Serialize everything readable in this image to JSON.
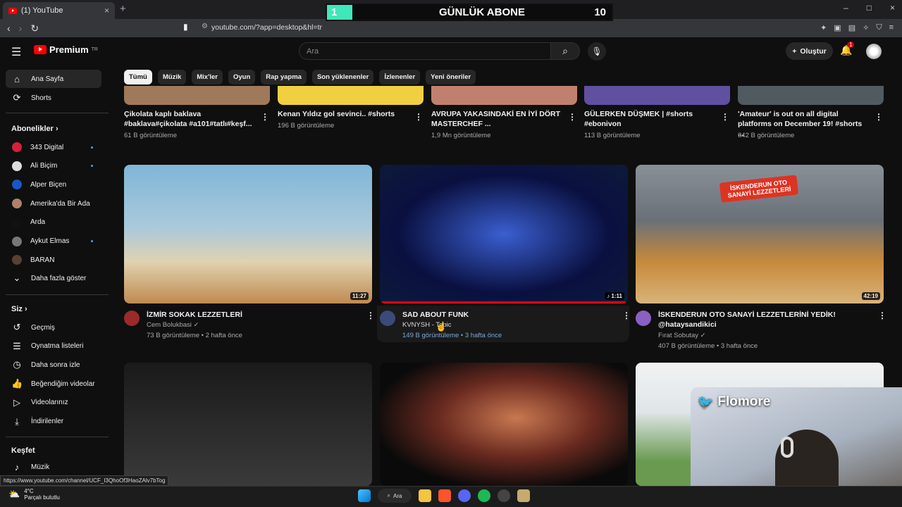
{
  "browser": {
    "tab_title": "(1) YouTube",
    "tab_close": "×",
    "new_tab": "+",
    "url": "youtube.com/?app=desktop&hl=tr",
    "window_controls": [
      "–",
      "□",
      "×"
    ]
  },
  "stream_overlay": {
    "left": "1",
    "title": "GÜNLÜK ABONE",
    "right": "10"
  },
  "header": {
    "brand": "Premium",
    "brand_sup": "TR",
    "search_placeholder": "Ara",
    "create_label": "Oluştur",
    "notifications": "1"
  },
  "sidebar": {
    "main": [
      {
        "label": "Ana Sayfa",
        "icon": "home-icon"
      },
      {
        "label": "Shorts",
        "icon": "shorts-icon"
      }
    ],
    "subscriptions_title": "Abonelikler",
    "subscriptions": [
      {
        "label": "343 Digital",
        "color": "#d6203a",
        "dot": true
      },
      {
        "label": "Ali Biçim",
        "color": "#dddddd",
        "dot": true
      },
      {
        "label": "Alper Biçen",
        "color": "#1a56c4",
        "dot": false
      },
      {
        "label": "Amerika'da Bir Ada",
        "color": "#b0806a",
        "dot": false
      },
      {
        "label": "Arda",
        "color": "#111111",
        "dot": false
      },
      {
        "label": "Aykut Elmas",
        "color": "#777777",
        "dot": true
      },
      {
        "label": "BARAN",
        "color": "#5a4030",
        "dot": false
      }
    ],
    "show_more": "Daha fazla göster",
    "you_title": "Siz",
    "you_items": [
      {
        "label": "Geçmiş",
        "icon": "history-icon"
      },
      {
        "label": "Oynatma listeleri",
        "icon": "playlist-icon"
      },
      {
        "label": "Daha sonra izle",
        "icon": "watch-later-icon"
      },
      {
        "label": "Beğendiğim videolar",
        "icon": "like-icon"
      },
      {
        "label": "Videolarınız",
        "icon": "your-videos-icon"
      },
      {
        "label": "İndirilenler",
        "icon": "download-icon"
      }
    ],
    "explore_title": "Keşfet",
    "explore_items": [
      {
        "label": "Müzik",
        "icon": "music-icon"
      }
    ]
  },
  "chips": [
    "Tümü",
    "Müzik",
    "Mix'ler",
    "Oyun",
    "Rap yapma",
    "Son yüklenenler",
    "İzlenenler",
    "Yeni öneriler"
  ],
  "shorts_row": [
    {
      "title1": "Çikolata kaplı baklava",
      "title2": "#baklava#çikolata #a101#tatlı#keşf...",
      "views": "61 B görüntüleme"
    },
    {
      "title1": "Kenan Yıldız gol sevinci.. #shorts",
      "title2": "",
      "views": "196 B görüntüleme"
    },
    {
      "title1": "AVRUPA YAKASINDAKİ EN İYİ DÖRT",
      "title2": "MASTERCHEF ...",
      "views": "1,9 Mn görüntüleme"
    },
    {
      "title1": "GÜLERKEN DÜŞMEK | #shorts",
      "title2": "#ebonivon",
      "views": "113 B görüntüleme"
    },
    {
      "title1": "'Amateur' is out on all digital",
      "title2": "platforms on December 19! #shorts ...",
      "views": "842 B görüntüleme"
    }
  ],
  "videos": [
    {
      "title": "İZMİR SOKAK LEZZETLERİ",
      "title2": "",
      "channel": "Cem Bolukbasi",
      "verified": "✓",
      "meta": "73 B görüntüleme • 2 hafta önce",
      "duration": "11:27"
    },
    {
      "title": "SAD ABOUT FUNK",
      "title2": "",
      "channel": "KVNYSH - Topic",
      "verified": "",
      "meta": "149 B görüntüleme • 3 hafta önce",
      "duration": "♪ 1:11"
    },
    {
      "title": "İSKENDERUN OTO SANAYİ LEZZETLERİNİ YEDİK!",
      "title2": "@hataysandikici",
      "channel": "Fırat Sobutay",
      "verified": "✓",
      "meta": "407 B görüntüleme • 3 hafta önce",
      "duration": "42:19"
    }
  ],
  "thumb_text": {
    "iskenderun": "İSKENDERUN OTO SANAYİ LEZZETLERİ"
  },
  "webcam": {
    "name": "Flomore"
  },
  "status_url": "https://www.youtube.com/channel/UCF_I3QhoOf3HaoZAlv7bTog",
  "taskbar": {
    "temp": "4°C",
    "weather": "Parçalı bulutlu",
    "search": "Ara"
  },
  "colors": {
    "accent": "#ff0000",
    "link": "#3ea6ff",
    "bg": "#0f0f0f"
  }
}
